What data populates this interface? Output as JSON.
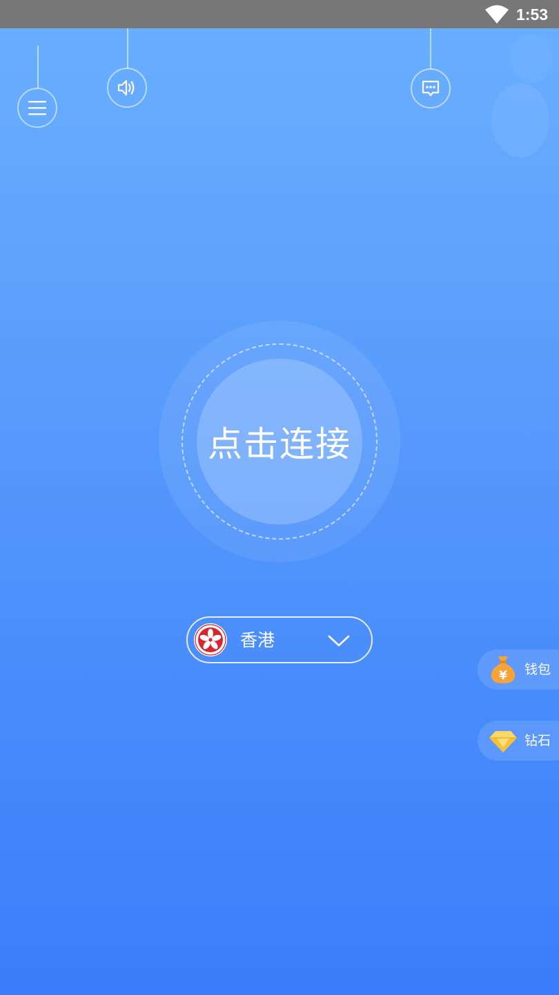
{
  "status_bar": {
    "time": "1:53"
  },
  "toolbar": {
    "menu_icon": "menu-icon",
    "sound_icon": "speaker-icon",
    "message_icon": "chat-icon"
  },
  "connect": {
    "label": "点击连接"
  },
  "region": {
    "name": "香港",
    "flag_icon": "hong-kong-flag-icon",
    "dropdown_icon": "chevron-down-icon"
  },
  "side_actions": {
    "wallet": {
      "label": "钱包",
      "icon": "money-bag-icon"
    },
    "diamond": {
      "label": "钻石",
      "icon": "diamond-icon"
    }
  },
  "colors": {
    "background_top": "#6ab0fe",
    "background_bottom": "#3a7dfc",
    "status_bar": "#777777",
    "flag_red": "#d8262f",
    "wallet_orange": "#f6a33a",
    "diamond_yellow": "#f7c23a"
  }
}
